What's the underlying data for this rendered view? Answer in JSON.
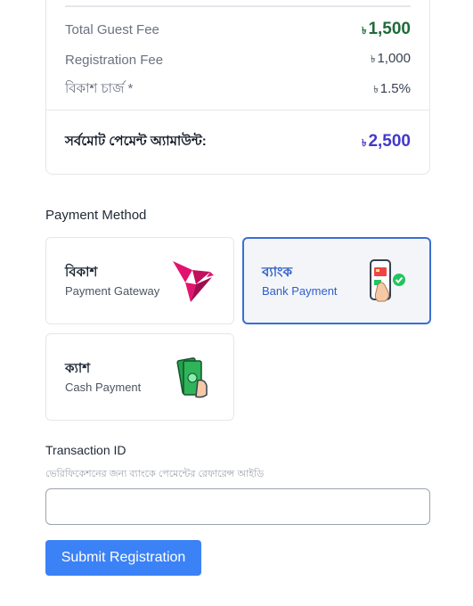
{
  "summary": {
    "currency_symbol": "৳",
    "rows": [
      {
        "label": "Total Guest Fee",
        "value": "1,500"
      },
      {
        "label": "Registration Fee",
        "value": "1,000"
      },
      {
        "label": "বিকাশ চার্জ *",
        "value": "1.5%"
      }
    ],
    "total": {
      "label": "সর্বমোট পেমেন্ট অ্যামাউন্ট:",
      "value": "2,500"
    }
  },
  "payment": {
    "heading": "Payment Method",
    "methods": [
      {
        "title": "বিকাশ",
        "subtitle": "Payment Gateway",
        "icon": "bkash-bird-icon",
        "selected": false
      },
      {
        "title": "ব্যাংক",
        "subtitle": "Bank Payment",
        "icon": "mobile-banking-icon",
        "selected": true
      },
      {
        "title": "ক্যাশ",
        "subtitle": "Cash Payment",
        "icon": "cash-in-hand-icon",
        "selected": false
      }
    ]
  },
  "transaction": {
    "label": "Transaction ID",
    "hint": "ভেরিফিকেশনের জন্য ব্যাংকে পেমেন্টের রেফারেন্স আইডি",
    "value": ""
  },
  "submit_label": "Submit Registration",
  "colors": {
    "accent": "#3b82f6",
    "selected_border": "#3b6fd4",
    "total": "#4338ca",
    "guest_fee": "#1f6b3a"
  }
}
